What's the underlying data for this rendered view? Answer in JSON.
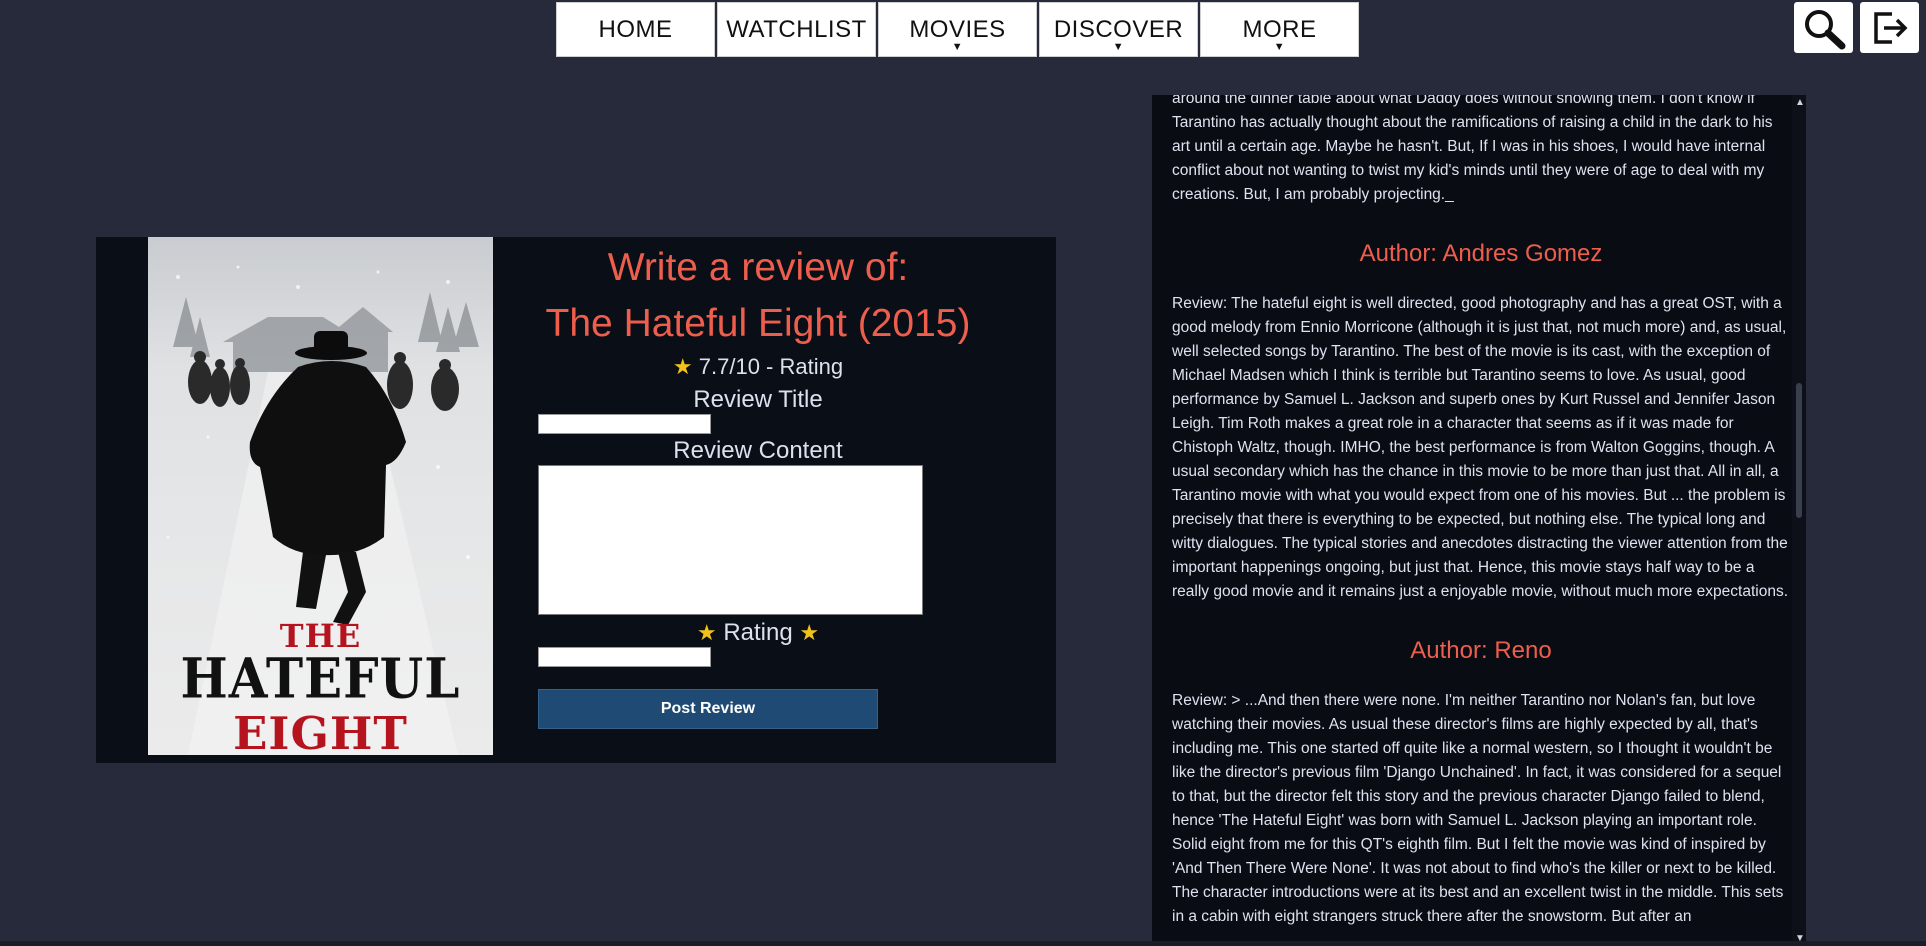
{
  "nav": {
    "items": [
      {
        "label": "HOME",
        "dropdown": false
      },
      {
        "label": "WATCHLIST",
        "dropdown": false
      },
      {
        "label": "MOVIES",
        "dropdown": true
      },
      {
        "label": "DISCOVER",
        "dropdown": true
      },
      {
        "label": "MORE",
        "dropdown": true
      }
    ],
    "caret": "▼",
    "icons": [
      "search-icon",
      "logout-icon"
    ]
  },
  "poster": {
    "title_line1": "THE",
    "title_line2": "HATEFUL",
    "title_line3": "EIGHT"
  },
  "form": {
    "heading_line1": "Write a review of:",
    "heading_line2": "The Hateful Eight (2015)",
    "rating_star": "★",
    "rating_text": "7.7/10 - Rating",
    "title_label": "Review Title",
    "title_value": "",
    "content_label": "Review Content",
    "content_value": "",
    "rating_label": "Rating",
    "rating_value": "",
    "post_label": "Post Review"
  },
  "reviews": {
    "partial_text": "around the dinner table about what Daddy does without showing them. I don't know if Tarantino has actually thought about the ramifications of raising a child in the dark to his art until a certain age. Maybe he hasn't. But, If I was in his shoes, I would have internal conflict about not wanting to twist my kid's minds until they were of age to deal with my creations. But, I am probably projecting._",
    "items": [
      {
        "author": "Author: Andres Gomez",
        "text": "Review: The hateful eight is well directed, good photography and has a great OST, with a good melody from Ennio Morricone (although it is just that, not much more) and, as usual, well selected songs by Tarantino. The best of the movie is its cast, with the exception of Michael Madsen which I think is terrible but Tarantino seems to love. As usual, good performance by Samuel L. Jackson and superb ones by Kurt Russel and Jennifer Jason Leigh. Tim Roth makes a great role in a character that seems as if it was made for Chistoph Waltz, though. IMHO, the best performance is from Walton Goggins, though. A usual secondary which has the chance in this movie to be more than just that. All in all, a Tarantino movie with what you would expect from one of his movies. But ... the problem is precisely that there is everything to be expected, but nothing else. The typical long and witty dialogues. The typical stories and anecdotes distracting the viewer attention from the important happenings ongoing, but just that. Hence, this movie stays half way to be a really good movie and it remains just a enjoyable movie, without much more expectations."
      },
      {
        "author": "Author: Reno",
        "text": "Review: > ...And then there were none. I'm neither Tarantino nor Nolan's fan, but love watching their movies. As usual these director's films are highly expected by all, that's including me. This one started off quite like a normal western, so I thought it wouldn't be like the director's previous film 'Django Unchained'. In fact, it was considered for a sequel to that, but the director felt this story and the previous character Django failed to blend, hence 'The Hateful Eight' was born with Samuel L. Jackson playing an important role. Solid eight from me for this QT's eighth film. But I felt the movie was kind of inspired by 'And Then There Were None'. It was not about to find who's the killer or next to be killed. The character introductions were at its best and an excellent twist in the middle. This sets in a cabin with eight strangers struck there after the snowstorm. But after an"
      }
    ],
    "scroll_up": "▲",
    "scroll_down": "▼"
  },
  "colors": {
    "background": "#262a3a",
    "accent": "#ee5e4d",
    "star": "#f2c21b",
    "button": "#1e4a74",
    "panel": "#090c13"
  }
}
